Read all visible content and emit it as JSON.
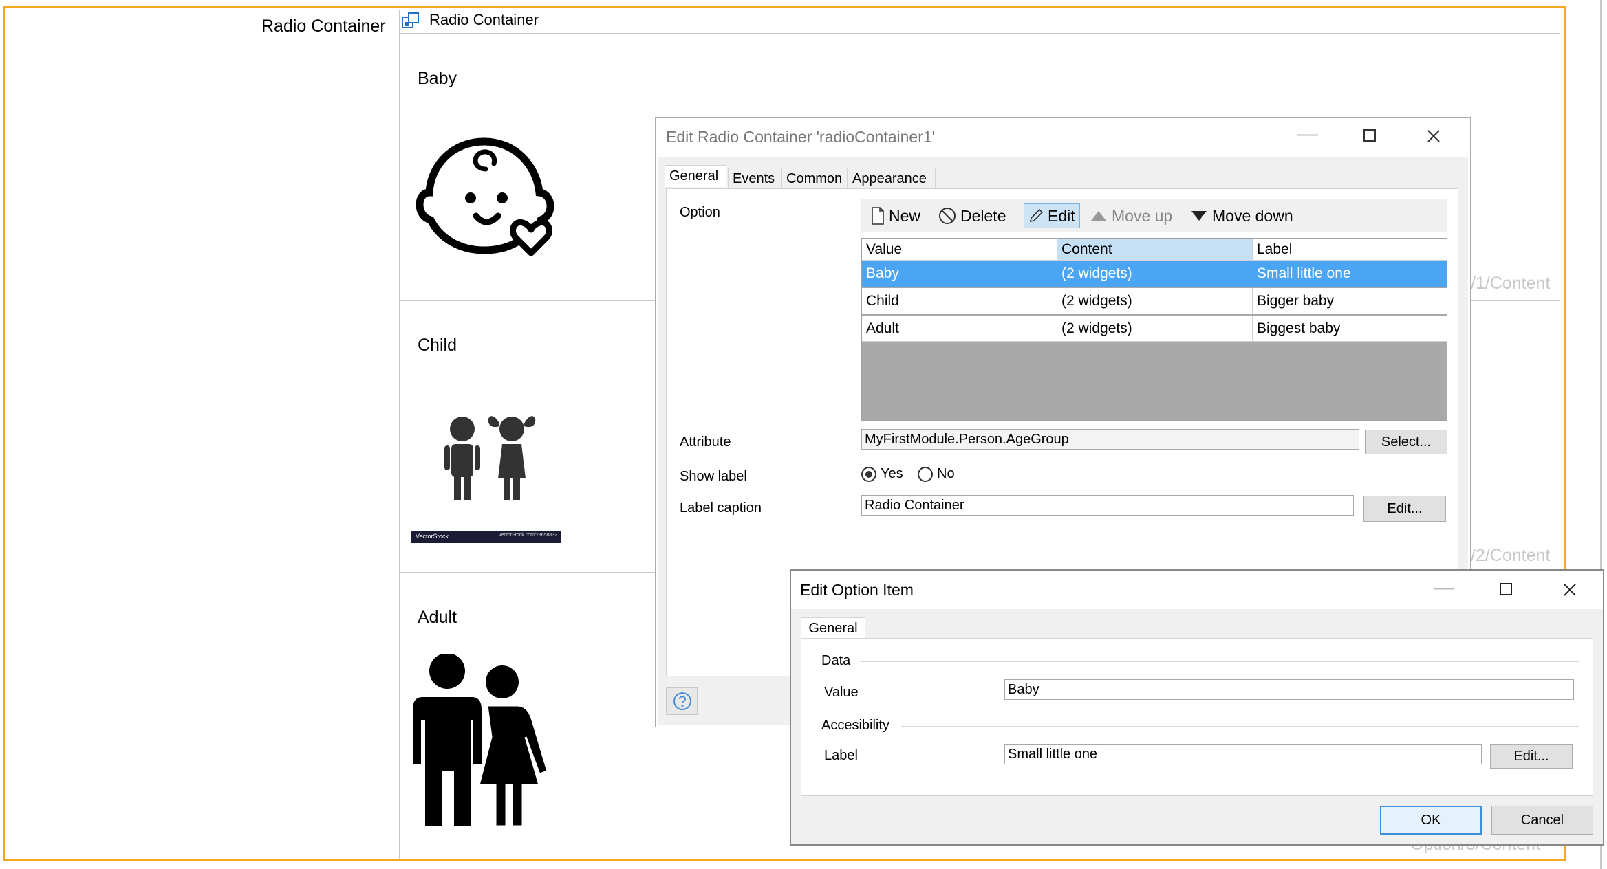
{
  "canvas": {
    "left_label": "Radio Container",
    "container_title": "Radio Container",
    "options": [
      {
        "label": "Baby",
        "ghost": "/1/Content"
      },
      {
        "label": "Child",
        "ghost": "/2/Content"
      },
      {
        "label": "Adult",
        "ghost": "Option/3/Content"
      }
    ],
    "image_caption_left": "VectorStock",
    "image_caption_right": "VectorStock.com/23658832",
    "accent_color": "#f5a623"
  },
  "dialog_edit_radio": {
    "title": "Edit Radio Container 'radioContainer1'",
    "tabs": [
      "General",
      "Events",
      "Common",
      "Appearance"
    ],
    "option_label": "Option",
    "toolbar": {
      "new": "New",
      "delete": "Delete",
      "edit": "Edit",
      "move_up": "Move up",
      "move_down": "Move down"
    },
    "grid": {
      "headers": [
        "Value",
        "Content",
        "Label"
      ],
      "rows": [
        [
          "Baby",
          "(2 widgets)",
          "Small little one"
        ],
        [
          "Child",
          "(2 widgets)",
          "Bigger baby"
        ],
        [
          "Adult",
          "(2 widgets)",
          "Biggest baby"
        ]
      ],
      "selected_row": 0,
      "selected_color": "#4aa6f5"
    },
    "attribute_label": "Attribute",
    "attribute_value": "MyFirstModule.Person.AgeGroup",
    "select_button": "Select...",
    "show_label_label": "Show label",
    "show_label_yes": "Yes",
    "show_label_no": "No",
    "label_caption_label": "Label caption",
    "label_caption_value": "Radio Container",
    "edit_button": "Edit..."
  },
  "dialog_edit_option": {
    "title": "Edit Option Item",
    "tab": "General",
    "data_group": "Data",
    "value_label": "Value",
    "value_value": "Baby",
    "accessibility_group": "Accesibility",
    "label_label": "Label",
    "label_value": "Small little one",
    "edit_button": "Edit...",
    "ok_button": "OK",
    "cancel_button": "Cancel"
  }
}
